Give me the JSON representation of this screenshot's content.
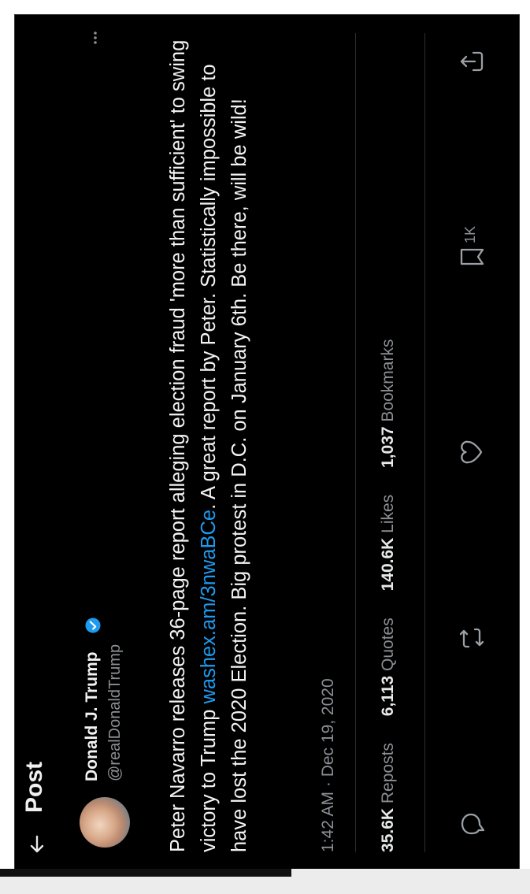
{
  "header": {
    "title": "Post",
    "back_icon": "arrow-left-icon"
  },
  "author": {
    "name": "Donald J. Trump",
    "handle": "@realDonaldTrump",
    "verified": true,
    "verified_color": "#1d9bf0"
  },
  "post": {
    "text_before_link": "Peter Navarro releases 36-page report alleging election fraud 'more than sufficient' to swing victory to Trump ",
    "link": "washex.am/3nwaBCe",
    "text_after_link": ". A great report by Peter. Statistically impossible to have lost the 2020 Election. Big protest in D.C. on January 6th. Be there, will be wild!",
    "timestamp": "1:42 AM · Dec 19, 2020"
  },
  "stats": {
    "reposts_count": "35.6K",
    "reposts_label": "Reposts",
    "quotes_count": "6,113",
    "quotes_label": "Quotes",
    "likes_count": "140.6K",
    "likes_label": "Likes",
    "bookmarks_count": "1,037",
    "bookmarks_label": "Bookmarks"
  },
  "actions": {
    "reply_icon": "reply-icon",
    "repost_icon": "repost-icon",
    "like_icon": "heart-icon",
    "bookmark_icon": "bookmark-icon",
    "bookmark_count": "1K",
    "share_icon": "share-icon"
  },
  "colors": {
    "background": "#000000",
    "text": "#e7e9ea",
    "secondary_text": "#8b8f94",
    "link": "#1d9bf0"
  }
}
